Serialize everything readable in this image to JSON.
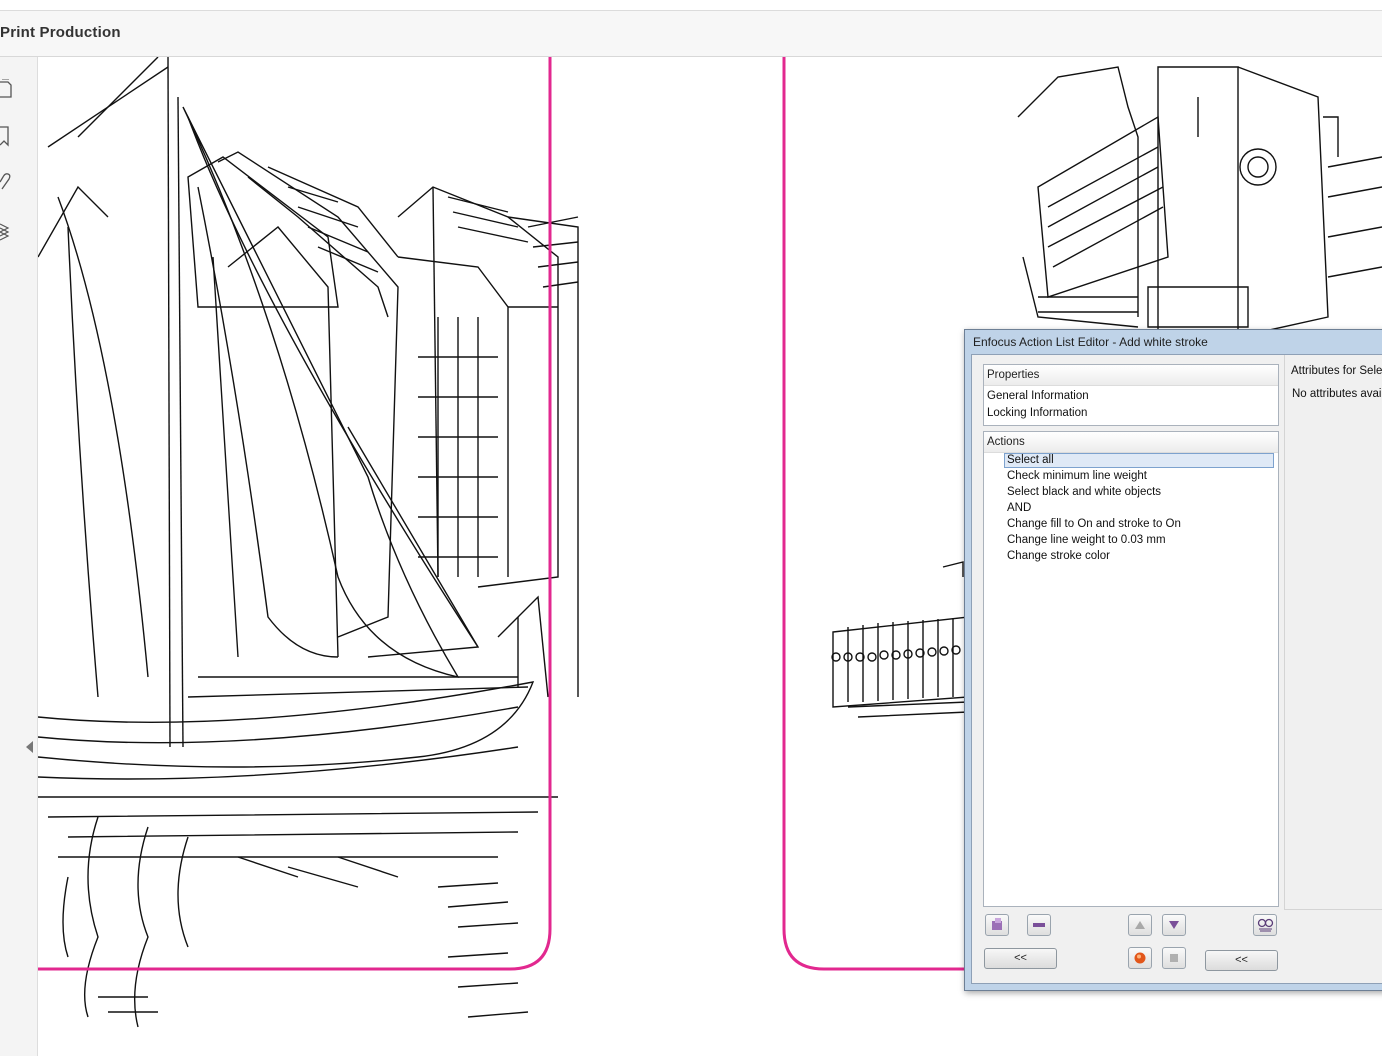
{
  "header": {
    "title": "Print Production"
  },
  "dialog": {
    "title": "Enfocus Action List Editor - Add white stroke",
    "properties": {
      "header": "Properties",
      "items": [
        "General Information",
        "Locking Information"
      ]
    },
    "actions": {
      "header": "Actions",
      "items": [
        "Select all",
        "Check minimum line weight",
        "Select black and white objects",
        "AND",
        "Change fill to On and stroke to On",
        "Change line weight to 0.03 mm",
        "Change stroke color"
      ],
      "selected_index": 0
    },
    "attributes_label": "Attributes for Selec",
    "no_attributes_text": "No attributes availa",
    "collapse_left_label": "<<",
    "collapse_right_label": "<<"
  },
  "colors": {
    "trim_box": "#e2288f",
    "selection": "#dfe9f6",
    "dialog_frame": "#bfd3e8"
  },
  "icons": [
    "pages-icon",
    "bookmark-icon",
    "attachment-icon",
    "layers-icon",
    "collapse-arrow-icon"
  ]
}
